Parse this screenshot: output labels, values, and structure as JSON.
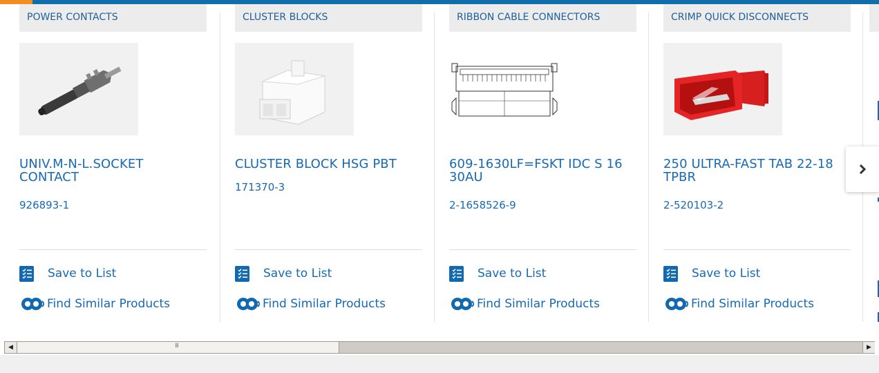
{
  "carousel": {
    "cards": [
      {
        "category": "POWER CONTACTS",
        "name": "UNIV.M-N-L.SOCKET CONTACT",
        "part_number": "926893-1",
        "image": "power-contact-image"
      },
      {
        "category": "CLUSTER BLOCKS",
        "name": "CLUSTER BLOCK HSG PBT",
        "part_number": "171370-3",
        "image": "cluster-block-image"
      },
      {
        "category": "RIBBON CABLE CONNECTORS",
        "name": "609-1630LF=FSKT IDC S 16 30AU",
        "part_number": "2-1658526-9",
        "image": "ribbon-connector-drawing"
      },
      {
        "category": "CRIMP QUICK DISCONNECTS",
        "name": "250 ULTRA-FAST TAB 22-18 TPBR",
        "part_number": "2-520103-2",
        "image": "crimp-disconnect-image"
      }
    ],
    "save_label": "Save to List",
    "find_label": "Find Similar Products",
    "next_icon": "chevron-right-icon"
  },
  "scrollbar": {
    "left_arrow": "◀",
    "right_arrow": "▶",
    "grip": "III"
  },
  "colors": {
    "brand_blue": "#1769b3",
    "accent_orange": "#f28d1f",
    "category_bg": "#ececec",
    "icon_blue": "#1269b0"
  }
}
